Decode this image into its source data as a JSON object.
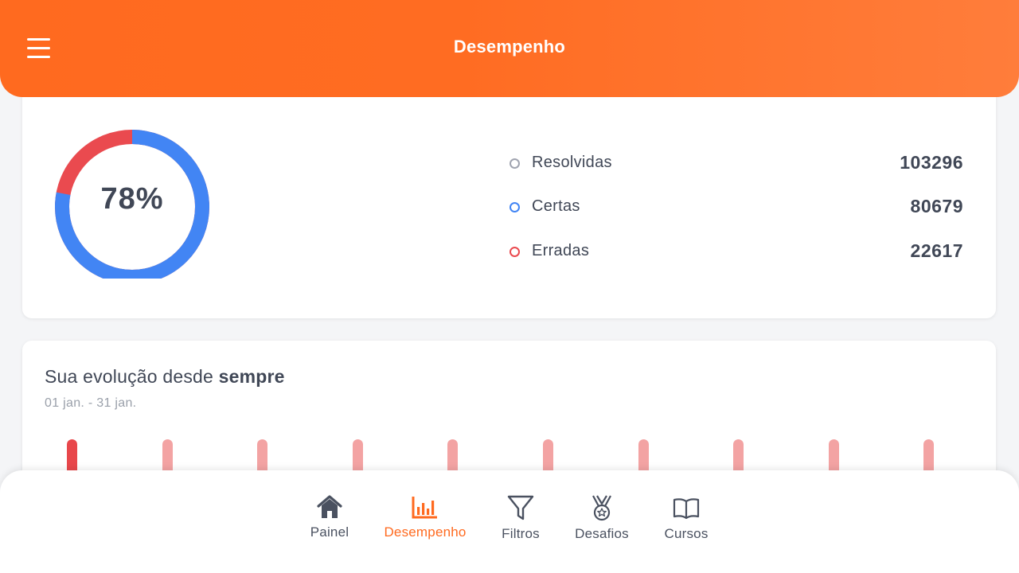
{
  "header": {
    "title": "Desempenho"
  },
  "summary": {
    "percent_label": "78%",
    "percent_value": 78,
    "colors": {
      "correct": "#4285f4",
      "wrong": "#ea4a4f",
      "resolved": "#a0a4b0"
    },
    "stats": [
      {
        "key": "resolvidas",
        "label": "Resolvidas",
        "value": "103296",
        "color": "#a0a4b0"
      },
      {
        "key": "certas",
        "label": "Certas",
        "value": "80679",
        "color": "#4285f4"
      },
      {
        "key": "erradas",
        "label": "Erradas",
        "value": "22617",
        "color": "#ea4a4f"
      }
    ]
  },
  "evolution": {
    "title_prefix": "Sua evolução desde ",
    "title_bold": "sempre",
    "period": "01 jan. - 31 jan.",
    "bar_count": 10,
    "active_index": 0
  },
  "nav": {
    "items": [
      {
        "key": "painel",
        "label": "Painel",
        "icon": "home-icon",
        "active": false
      },
      {
        "key": "desempenho",
        "label": "Desempenho",
        "icon": "bar-chart-icon",
        "active": true
      },
      {
        "key": "filtros",
        "label": "Filtros",
        "icon": "filter-icon",
        "active": false
      },
      {
        "key": "desafios",
        "label": "Desafios",
        "icon": "medal-icon",
        "active": false
      },
      {
        "key": "cursos",
        "label": "Cursos",
        "icon": "book-icon",
        "active": false
      }
    ],
    "active_color": "#ff6a1f"
  }
}
